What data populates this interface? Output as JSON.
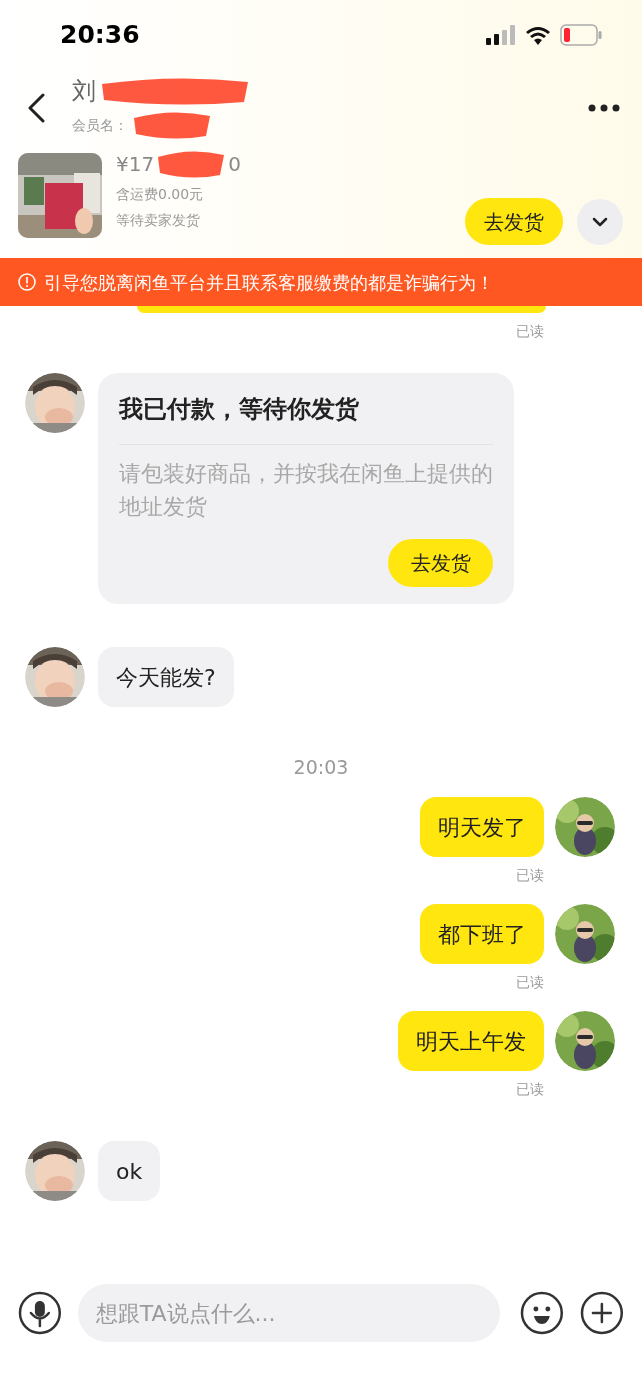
{
  "status_bar": {
    "time": "20:36"
  },
  "header": {
    "name": "刘",
    "member_label": "会员名："
  },
  "product": {
    "price_start": "¥17",
    "price_end": "0",
    "shipping": "含运费0.00元",
    "status": "等待卖家发货",
    "button": "去发货"
  },
  "banner": {
    "text": "引导您脱离闲鱼平台并且联系客服缴费的都是诈骗行为！"
  },
  "messages": [
    {
      "kind": "partial_out",
      "receipt": "已读"
    },
    {
      "kind": "card",
      "title": "我已付款，等待你发货",
      "body": "请包装好商品，并按我在闲鱼上提供的地址发货",
      "button": "去发货"
    },
    {
      "kind": "in",
      "text": "今天能发?"
    },
    {
      "kind": "time",
      "text": "20:03"
    },
    {
      "kind": "out",
      "text": "明天发了",
      "receipt": "已读"
    },
    {
      "kind": "out",
      "text": "都下班了",
      "receipt": "已读"
    },
    {
      "kind": "out",
      "text": "明天上午发",
      "receipt": "已读"
    },
    {
      "kind": "in",
      "text": "ok"
    }
  ],
  "input": {
    "placeholder": "想跟TA说点什么..."
  }
}
